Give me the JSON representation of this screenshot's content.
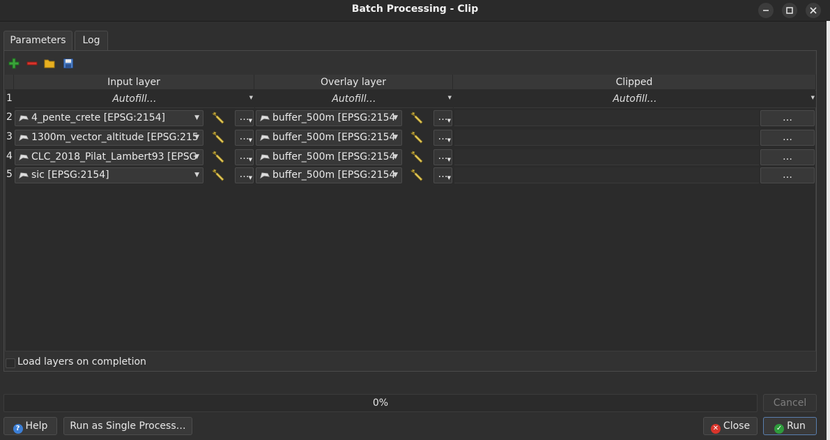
{
  "window": {
    "title": "Batch Processing - Clip",
    "controls": [
      "minimize",
      "maximize",
      "close"
    ]
  },
  "tabs": [
    {
      "label": "Parameters",
      "active": true
    },
    {
      "label": "Log",
      "active": false
    }
  ],
  "toolbar": {
    "icons": [
      "add-row-icon",
      "remove-row-icon",
      "open-folder-icon",
      "save-icon"
    ]
  },
  "table": {
    "columns": [
      "Input layer",
      "Overlay layer",
      "Clipped"
    ],
    "autofill_row": {
      "row_number": "1",
      "input": "Autofill…",
      "overlay": "Autofill…",
      "clipped": "Autofill…"
    },
    "rows": [
      {
        "row_number": "2",
        "input_layer": "4_pente_crete [EPSG:2154]",
        "overlay_layer": "buffer_500m [EPSG:2154",
        "dots": "…",
        "output_button": "…"
      },
      {
        "row_number": "3",
        "input_layer": "1300m_vector_altitude [EPSG:215",
        "overlay_layer": "buffer_500m [EPSG:2154",
        "dots": "…",
        "output_button": "…"
      },
      {
        "row_number": "4",
        "input_layer": "CLC_2018_Pilat_Lambert93 [EPSG",
        "overlay_layer": "buffer_500m [EPSG:2154",
        "dots": "…",
        "output_button": "…"
      },
      {
        "row_number": "5",
        "input_layer": "sic [EPSG:2154]",
        "overlay_layer": "buffer_500m [EPSG:2154",
        "dots": "…",
        "output_button": "…"
      }
    ]
  },
  "load_layers": {
    "label": "Load layers on completion",
    "checked": false
  },
  "progress": {
    "text": "0%",
    "value": 0
  },
  "buttons": {
    "cancel": "Cancel",
    "help": "Help",
    "run_single": "Run as Single Process…",
    "close": "Close",
    "run": "Run"
  },
  "colors": {
    "background": "#2f2f2f",
    "accent": "#5a7fae",
    "close_icon": "#d9342b",
    "run_icon": "#2e9b3c"
  }
}
